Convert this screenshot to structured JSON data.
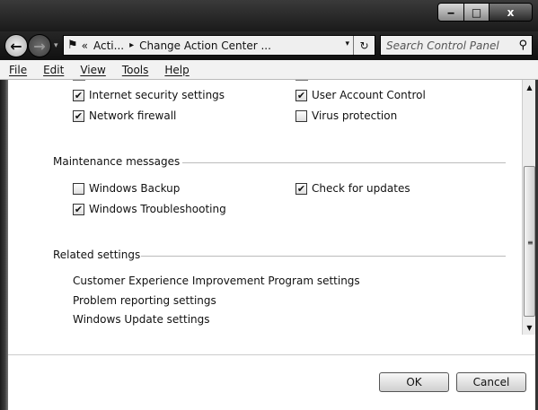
{
  "window": {
    "minimize_glyph": "‒",
    "maximize_glyph": "□",
    "close_glyph": "x"
  },
  "nav": {
    "back_glyph": "←",
    "forward_glyph": "→",
    "history_glyph": "▾",
    "address_icon": "flag-icon",
    "address_overflow": "«",
    "crumb1": "Acti...",
    "separator": "▸",
    "crumb2": "Change Action Center ...",
    "dropdown_glyph": "▾",
    "refresh_glyph": "↻",
    "search_placeholder": "Search Control Panel",
    "search_icon": "⚲"
  },
  "menu": {
    "file": "File",
    "edit": "Edit",
    "view": "View",
    "tools": "Tools",
    "help": "Help"
  },
  "security": {
    "internet_security": {
      "label": "Internet security settings",
      "checked": true
    },
    "uac": {
      "label": "User Account Control",
      "checked": true
    },
    "firewall": {
      "label": "Network firewall",
      "checked": true
    },
    "virus": {
      "label": "Virus protection",
      "checked": false
    }
  },
  "maintenance": {
    "title": "Maintenance messages",
    "backup": {
      "label": "Windows Backup",
      "checked": false
    },
    "updates": {
      "label": "Check for updates",
      "checked": true
    },
    "troubleshooting": {
      "label": "Windows Troubleshooting",
      "checked": true
    }
  },
  "related": {
    "title": "Related settings",
    "links": [
      "Customer Experience Improvement Program settings",
      "Problem reporting settings",
      "Windows Update settings"
    ]
  },
  "scrollbar": {
    "up_glyph": "▲",
    "down_glyph": "▼",
    "grip_glyph": "≡"
  },
  "buttons": {
    "ok": "OK",
    "cancel": "Cancel"
  },
  "check_glyph": "✔"
}
